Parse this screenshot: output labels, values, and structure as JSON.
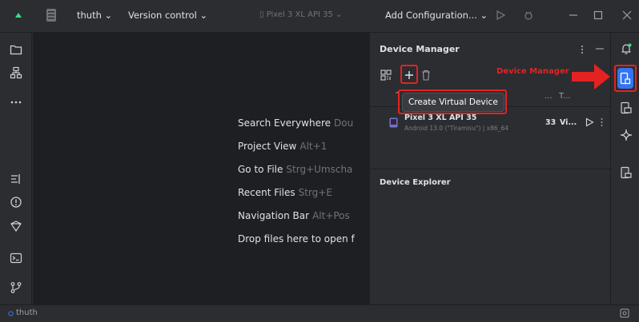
{
  "titlebar": {
    "project": "thuth",
    "vcs": "Version control",
    "device": "Pixel 3 XL API 35",
    "run_config": "Add Configuration..."
  },
  "editor": {
    "hints": [
      {
        "label": "Search Everywhere",
        "key": "Dou"
      },
      {
        "label": "Project View",
        "key": "Alt+1"
      },
      {
        "label": "Go to File",
        "key": "Strg+Umscha"
      },
      {
        "label": "Recent Files",
        "key": "Strg+E"
      },
      {
        "label": "Navigation Bar",
        "key": "Alt+Pos"
      },
      {
        "label": "Drop files here to open f",
        "key": ""
      }
    ]
  },
  "device_manager": {
    "title": "Device Manager",
    "tooltip": "Create Virtual Device",
    "col_more": "...",
    "col_t": "T...",
    "device": {
      "name": "Pixel 3 XL API 35",
      "subtitle": "Android 13.0 (\"Tiramisu\") | x86_64",
      "api": "33",
      "type": "Vi..."
    }
  },
  "device_explorer": {
    "title": "Device Explorer"
  },
  "annotation": {
    "label": "Device Manager",
    "color": "#e52222"
  },
  "status": {
    "project": "thuth"
  },
  "colors": {
    "accent": "#3574f0",
    "annotation_red": "#e52222",
    "android_green": "#3ddc84"
  }
}
